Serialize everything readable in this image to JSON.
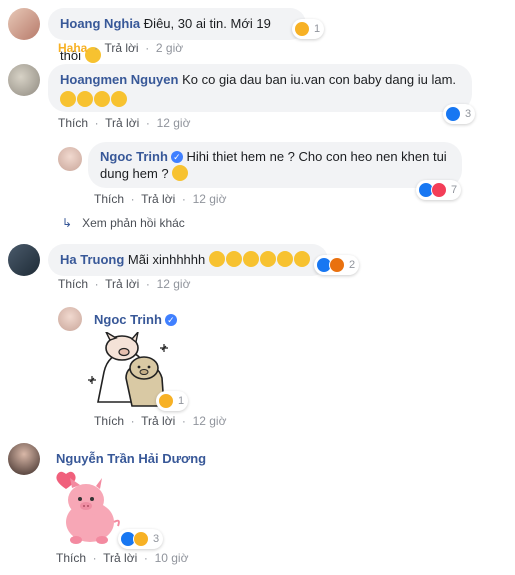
{
  "comments": [
    {
      "author": "Hoang Nghia",
      "text": "Điêu, 30 ai tin. Mới 19 thôi",
      "reaction_count": "1",
      "actions": {
        "reaction": "Haha",
        "reply": "Trả lời",
        "time": "2 giờ"
      }
    },
    {
      "author": "Hoangmen Nguyen",
      "text_line1": "Ko co gia dau ban iu.van con baby dang iu lam.",
      "reaction_count": "3",
      "actions": {
        "like": "Thích",
        "reply": "Trả lời",
        "time": "12 giờ"
      }
    },
    {
      "author": "Ngoc Trinh",
      "text_line1": "Hihi thiet hem ne ? Cho con heo nen khen tui",
      "text_line2": "dung hem ?",
      "reaction_count": "7",
      "actions": {
        "like": "Thích",
        "reply": "Trả lời",
        "time": "12 giờ"
      }
    },
    {
      "more_replies": "Xem phản hồi khác"
    },
    {
      "author": "Ha Truong",
      "text": "Mãi xinhhhhh",
      "reaction_count": "2",
      "actions": {
        "like": "Thích",
        "reply": "Trả lời",
        "time": "12 giờ"
      }
    },
    {
      "author": "Ngoc Trinh",
      "reaction_count": "1",
      "actions": {
        "like": "Thích",
        "reply": "Trả lời",
        "time": "12 giờ"
      }
    },
    {
      "author": "Nguyễn Trần Hải Dương",
      "reaction_count": "3",
      "actions": {
        "like": "Thích",
        "reply": "Trả lời",
        "time": "10 giờ"
      }
    }
  ],
  "colors": {
    "author": "#385898",
    "bubble": "#f2f3f5",
    "meta": "#90949c",
    "haha": "#f7b125",
    "like": "#1877f2",
    "love": "#f33e58"
  }
}
